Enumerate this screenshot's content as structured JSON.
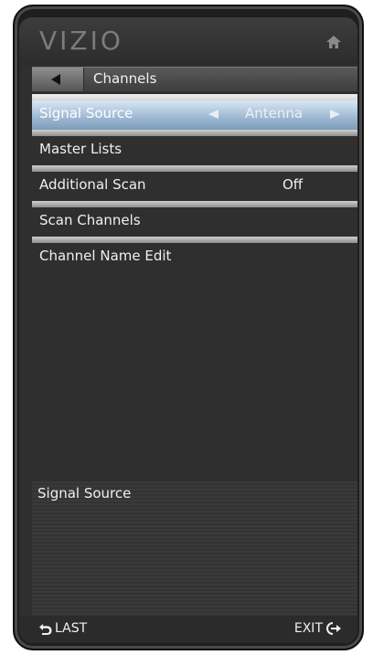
{
  "header": {
    "logo": "VIZIO",
    "home_icon": "home-icon"
  },
  "breadcrumb": {
    "back_icon": "back-arrow-icon",
    "title": "Channels"
  },
  "menu": {
    "items": [
      {
        "label": "Signal Source",
        "value": "Antenna",
        "selected": true
      },
      {
        "label": "Master Lists",
        "value": ""
      },
      {
        "label": "Additional Scan",
        "value": "Off"
      },
      {
        "label": "Scan Channels",
        "value": ""
      },
      {
        "label": "Channel Name Edit",
        "value": ""
      }
    ]
  },
  "description": {
    "text": "Signal Source"
  },
  "footer": {
    "last_label": "LAST",
    "exit_label": "EXIT"
  },
  "colors": {
    "selected_highlight": "#9cb7d2",
    "background": "#2f2f2f"
  }
}
